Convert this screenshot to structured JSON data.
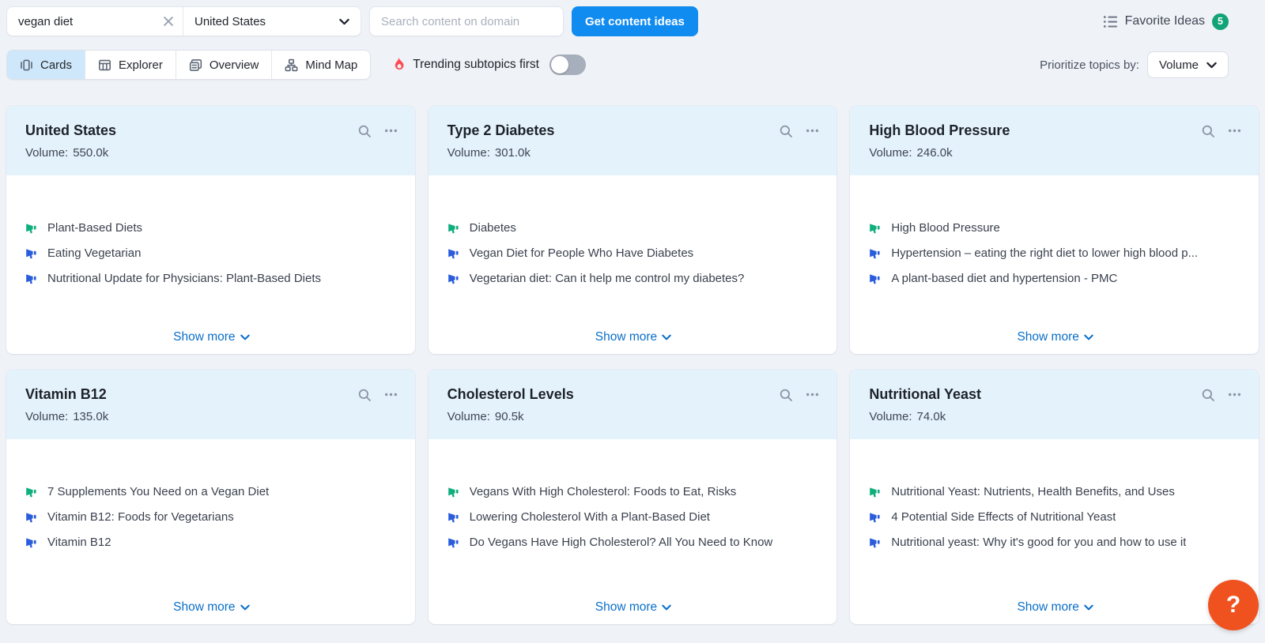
{
  "toolbar": {
    "keyword": {
      "value": "vegan diet"
    },
    "country": {
      "value": "United States"
    },
    "domain": {
      "placeholder": "Search content on domain"
    },
    "submit_label": "Get content ideas",
    "favorites": {
      "label": "Favorite Ideas",
      "count": "5"
    }
  },
  "view_bar": {
    "tabs": [
      {
        "label": "Cards",
        "icon": "cards-icon",
        "active": true
      },
      {
        "label": "Explorer",
        "icon": "table-icon",
        "active": false
      },
      {
        "label": "Overview",
        "icon": "window-icon",
        "active": false
      },
      {
        "label": "Mind Map",
        "icon": "sitemap-icon",
        "active": false
      }
    ],
    "trending": {
      "label": "Trending subtopics first",
      "enabled": false
    },
    "prioritize": {
      "label": "Prioritize topics by:",
      "value": "Volume"
    }
  },
  "card_labels": {
    "volume": "Volume:",
    "show_more": "Show more"
  },
  "cards": [
    {
      "title": "United States",
      "volume": "550.0k",
      "items": [
        {
          "icon": "megaphone-green-icon",
          "text": "Plant-Based Diets"
        },
        {
          "icon": "megaphone-blue-icon",
          "text": "Eating Vegetarian"
        },
        {
          "icon": "megaphone-blue-icon",
          "text": "Nutritional Update for Physicians: Plant-Based Diets"
        }
      ]
    },
    {
      "title": "Type 2 Diabetes",
      "volume": "301.0k",
      "items": [
        {
          "icon": "megaphone-green-icon",
          "text": "Diabetes"
        },
        {
          "icon": "megaphone-blue-icon",
          "text": "Vegan Diet for People Who Have Diabetes"
        },
        {
          "icon": "megaphone-blue-icon",
          "text": "Vegetarian diet: Can it help me control my diabetes?"
        }
      ]
    },
    {
      "title": "High Blood Pressure",
      "volume": "246.0k",
      "items": [
        {
          "icon": "megaphone-green-icon",
          "text": "High Blood Pressure"
        },
        {
          "icon": "megaphone-blue-icon",
          "text": "Hypertension – eating the right diet to lower high blood p..."
        },
        {
          "icon": "megaphone-blue-icon",
          "text": "A plant-based diet and hypertension - PMC"
        }
      ]
    },
    {
      "title": "Vitamin B12",
      "volume": "135.0k",
      "items": [
        {
          "icon": "megaphone-green-icon",
          "text": "7 Supplements You Need on a Vegan Diet"
        },
        {
          "icon": "megaphone-blue-icon",
          "text": "Vitamin B12: Foods for Vegetarians"
        },
        {
          "icon": "megaphone-blue-icon",
          "text": "Vitamin B12"
        }
      ]
    },
    {
      "title": "Cholesterol Levels",
      "volume": "90.5k",
      "items": [
        {
          "icon": "megaphone-green-icon",
          "text": "Vegans With High Cholesterol: Foods to Eat, Risks"
        },
        {
          "icon": "megaphone-blue-icon",
          "text": "Lowering Cholesterol With a Plant-Based Diet"
        },
        {
          "icon": "megaphone-blue-icon",
          "text": "Do Vegans Have High Cholesterol? All You Need to Know"
        }
      ]
    },
    {
      "title": "Nutritional Yeast",
      "volume": "74.0k",
      "items": [
        {
          "icon": "megaphone-green-icon",
          "text": "Nutritional Yeast: Nutrients, Health Benefits, and Uses"
        },
        {
          "icon": "megaphone-blue-icon",
          "text": "4 Potential Side Effects of Nutritional Yeast"
        },
        {
          "icon": "megaphone-blue-icon",
          "text": "Nutritional yeast: Why it's good for you and how to use it"
        }
      ]
    }
  ],
  "help": {
    "label": "?"
  },
  "colors": {
    "page_background": "#EFF2F7",
    "card_header_background": "#E4F2FC",
    "primary_button_blue": "#108BF0",
    "link_blue": "#0A6FC8",
    "active_tab_blue": "#CEE7FA",
    "badge_green": "#12A377",
    "megaphone_green": "#0FAE7D",
    "megaphone_blue": "#2A5CDB",
    "flame_red": "#FF4953",
    "help_orange": "#F0521F"
  }
}
